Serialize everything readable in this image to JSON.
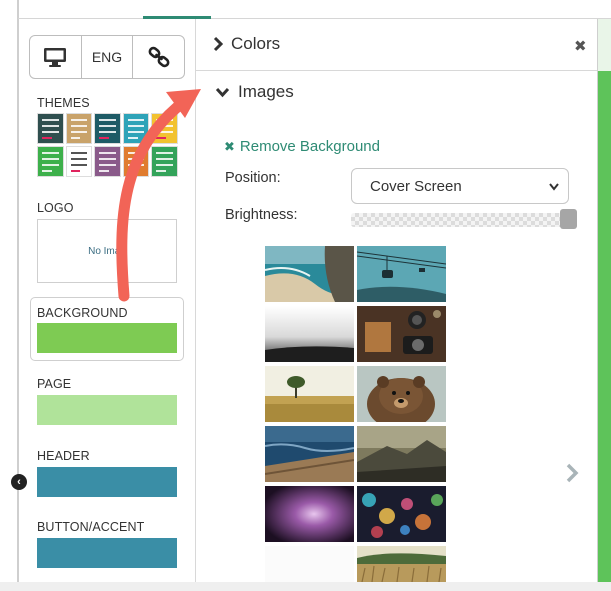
{
  "toolbar": {
    "device_icon": "monitor-icon",
    "language_label": "ENG",
    "link_icon": "link-icon"
  },
  "sidebar": {
    "themes_label": "THEMES",
    "theme_colors": [
      "#2f4f4f",
      "#c9a36a",
      "#1e5b66",
      "#2ea3b8",
      "#f2c230",
      "#3db04b",
      "#ffffff",
      "#8a5a8a",
      "#e07c2f",
      "#33a35a"
    ],
    "logo_label": "LOGO",
    "logo_placeholder": "No Imag",
    "background_label": "BACKGROUND",
    "background_color": "#7ecb53",
    "page_label": "PAGE",
    "page_color": "#b0e39a",
    "header_label": "HEADER",
    "header_color": "#3a8ea6",
    "button_accent_label": "BUTTON/ACCENT",
    "button_accent_color": "#3a8ea6",
    "collapse_icon": "chevron-left-icon"
  },
  "panel": {
    "colors_heading": "Colors",
    "close_icon": "close-icon",
    "images_heading": "Images",
    "remove_background_label": "Remove Background",
    "position_label": "Position:",
    "position_value": "Cover Screen",
    "brightness_label": "Brightness:",
    "brightness_level": 1.0,
    "next_icon": "chevron-right-icon"
  },
  "gallery": {
    "images": [
      "beach-coast-image",
      "cable-car-image",
      "foggy-landscape-image",
      "camera-desk-image",
      "lone-tree-field-image",
      "bear-image",
      "ocean-pier-image",
      "mountain-haze-image",
      "purple-bokeh-image",
      "color-bokeh-image",
      "white-blank-image",
      "wheat-field-image"
    ]
  },
  "colors": {
    "accent": "#2e8b74",
    "annotation_arrow": "#f26457",
    "right_strip": "#5ec35a"
  }
}
